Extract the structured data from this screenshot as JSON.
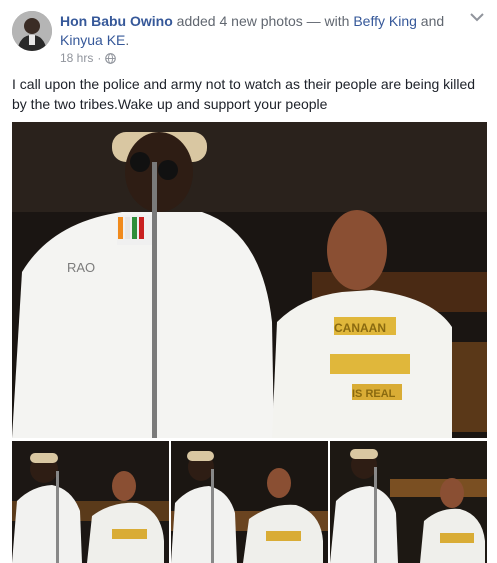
{
  "post": {
    "author": "Hon Babu Owino",
    "action_text": "added 4 new photos — with",
    "tagged_1": "Beffy King",
    "conjunction": "and",
    "tagged_2": "Kinyua KE",
    "period": ".",
    "timestamp": "18 hrs",
    "separator": "·",
    "privacy_icon": "globe-icon",
    "menu_icon": "chevron-down-icon",
    "body": "I call upon the police and army not to watch as their people are being killed by the two tribes.Wake up and support your people"
  },
  "photos": {
    "count": 4,
    "shirt_text_left": "RAO",
    "shirt_text_right_1": "CANAAN",
    "shirt_text_right_2": "IS REAL"
  },
  "colors": {
    "link": "#365899",
    "text": "#1d2129",
    "meta": "#90949c"
  }
}
